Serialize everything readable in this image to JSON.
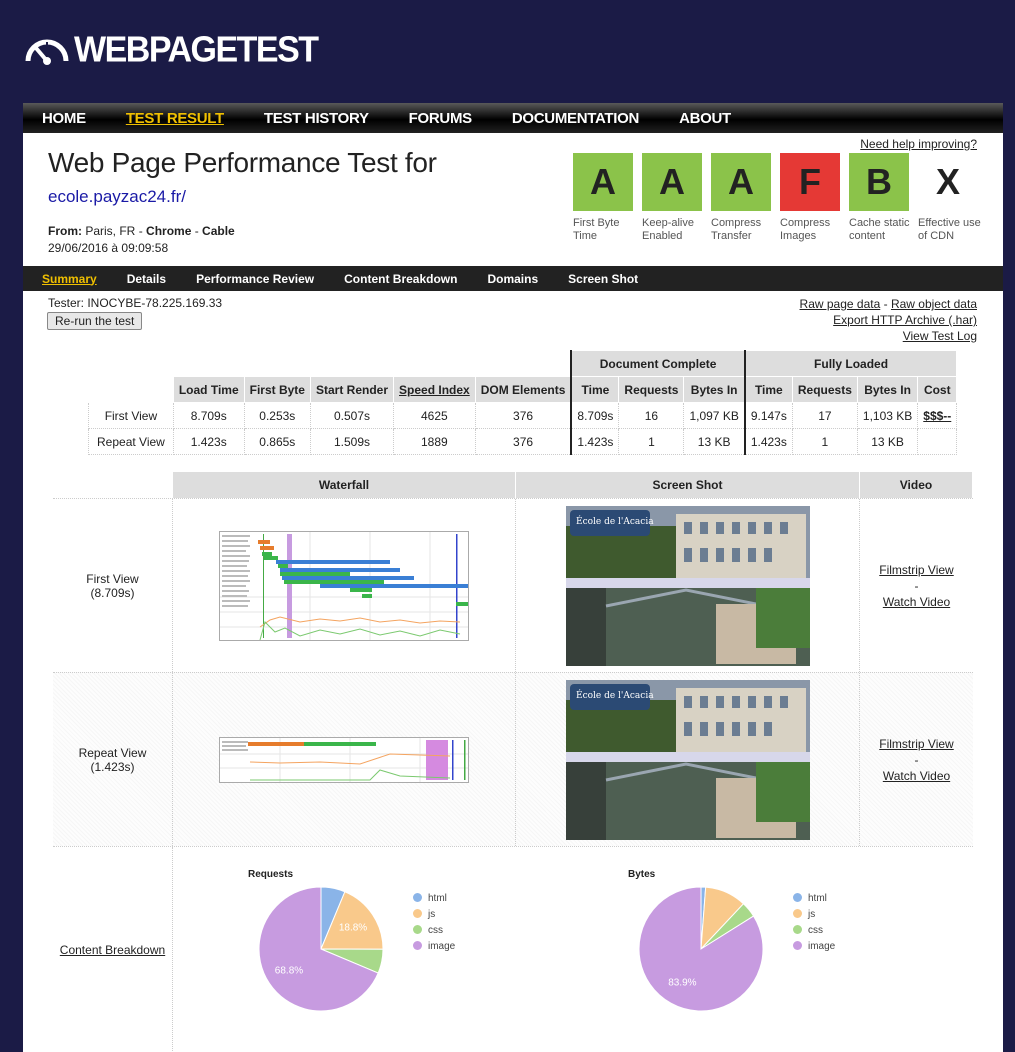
{
  "logo": {
    "text": "WEBPAGETEST"
  },
  "nav": [
    {
      "label": "HOME",
      "active": false
    },
    {
      "label": "TEST RESULT",
      "active": true
    },
    {
      "label": "TEST HISTORY",
      "active": false
    },
    {
      "label": "FORUMS",
      "active": false
    },
    {
      "label": "DOCUMENTATION",
      "active": false
    },
    {
      "label": "ABOUT",
      "active": false
    }
  ],
  "header": {
    "title": "Web Page Performance Test for",
    "url": "ecole.payzac24.fr/",
    "from_label": "From:",
    "from_location": "Paris, FR",
    "from_sep": " - ",
    "browser": "Chrome",
    "connection": "Cable",
    "date": "29/06/2016 à 09:09:58",
    "help_link": "Need help improving?"
  },
  "grades": [
    {
      "grade": "A",
      "label": "First Byte Time",
      "color": "#8bc34a"
    },
    {
      "grade": "A",
      "label": "Keep-alive Enabled",
      "color": "#8bc34a"
    },
    {
      "grade": "A",
      "label": "Compress Transfer",
      "color": "#8bc34a"
    },
    {
      "grade": "F",
      "label": "Compress Images",
      "color": "#e53935"
    },
    {
      "grade": "B",
      "label": "Cache static content",
      "color": "#8bc34a"
    },
    {
      "grade": "X",
      "label": "Effective use of CDN",
      "color": "#ffffff"
    }
  ],
  "subnav": [
    {
      "label": "Summary",
      "active": true
    },
    {
      "label": "Details",
      "active": false
    },
    {
      "label": "Performance Review",
      "active": false
    },
    {
      "label": "Content Breakdown",
      "active": false
    },
    {
      "label": "Domains",
      "active": false
    },
    {
      "label": "Screen Shot",
      "active": false
    }
  ],
  "tester": "Tester: INOCYBE-78.225.169.33",
  "rerun_label": "Re-run the test",
  "raw_links": {
    "raw_page": "Raw page data",
    "dash": " - ",
    "raw_object": "Raw object data",
    "har": "Export HTTP Archive (.har)",
    "log": "View Test Log"
  },
  "results": {
    "group_doc": "Document Complete",
    "group_full": "Fully Loaded",
    "columns": [
      "Load Time",
      "First Byte",
      "Start Render",
      "Speed Index",
      "DOM Elements",
      "Time",
      "Requests",
      "Bytes In",
      "Time",
      "Requests",
      "Bytes In",
      "Cost"
    ],
    "rows": [
      {
        "label": "First View",
        "values": [
          "8.709s",
          "0.253s",
          "0.507s",
          "4625",
          "376",
          "8.709s",
          "16",
          "1,097 KB",
          "9.147s",
          "17",
          "1,103 KB",
          "$$$--"
        ]
      },
      {
        "label": "Repeat View",
        "values": [
          "1.423s",
          "0.865s",
          "1.509s",
          "1889",
          "376",
          "1.423s",
          "1",
          "13 KB",
          "1.423s",
          "1",
          "13 KB",
          ""
        ]
      }
    ]
  },
  "grid": {
    "headers": [
      "Waterfall",
      "Screen Shot",
      "Video"
    ],
    "rows": [
      {
        "label": "First View",
        "time": "(8.709s)",
        "filmstrip": "Filmstrip View",
        "dash": "-",
        "video": "Watch Video"
      },
      {
        "label": "Repeat View",
        "time": "(1.423s)",
        "filmstrip": "Filmstrip View",
        "dash": "-",
        "video": "Watch Video"
      }
    ],
    "screenshot_title": "École de l'Acacia",
    "content_breakdown": "Content Breakdown"
  },
  "chart_data": [
    {
      "type": "pie",
      "title": "Requests",
      "categories": [
        "html",
        "js",
        "css",
        "image"
      ],
      "values": [
        6.3,
        18.8,
        6.3,
        68.8
      ],
      "colors": [
        "#8ab4e8",
        "#f9c98b",
        "#a8d98a",
        "#c79be0"
      ],
      "labels_shown": {
        "js": "18.8%",
        "image": "68.8%"
      }
    },
    {
      "type": "pie",
      "title": "Bytes",
      "categories": [
        "html",
        "js",
        "css",
        "image"
      ],
      "values": [
        1.2,
        10.8,
        4.1,
        83.9
      ],
      "colors": [
        "#8ab4e8",
        "#f9c98b",
        "#a8d98a",
        "#c79be0"
      ],
      "labels_shown": {
        "image": "83.9%"
      }
    }
  ]
}
